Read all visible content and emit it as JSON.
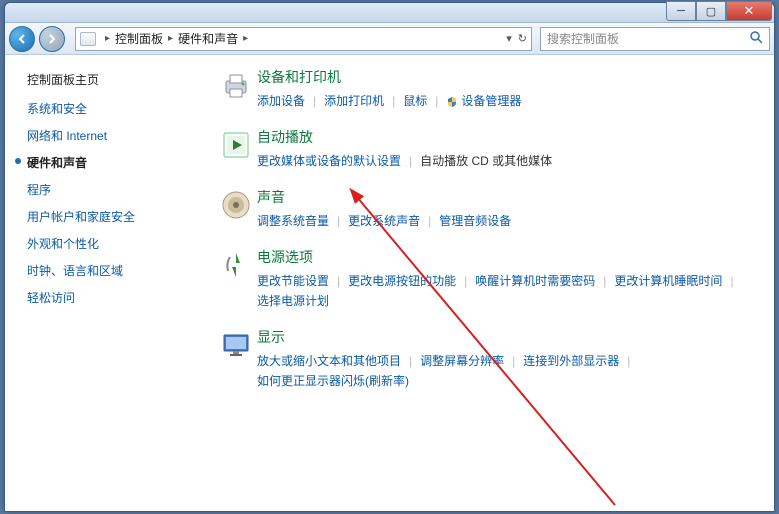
{
  "window": {
    "breadcrumb": {
      "root": "控制面板",
      "current": "硬件和声音"
    },
    "search_placeholder": "搜索控制面板"
  },
  "sidebar": {
    "title": "控制面板主页",
    "items": [
      {
        "label": "系统和安全",
        "active": false
      },
      {
        "label": "网络和 Internet",
        "active": false
      },
      {
        "label": "硬件和声音",
        "active": true
      },
      {
        "label": "程序",
        "active": false
      },
      {
        "label": "用户帐户和家庭安全",
        "active": false
      },
      {
        "label": "外观和个性化",
        "active": false
      },
      {
        "label": "时钟、语言和区域",
        "active": false
      },
      {
        "label": "轻松访问",
        "active": false
      }
    ]
  },
  "sections": [
    {
      "title": "设备和打印机",
      "icon": "printer",
      "links": [
        {
          "text": "添加设备"
        },
        {
          "sep": true
        },
        {
          "text": "添加打印机"
        },
        {
          "sep": true
        },
        {
          "text": "鼠标"
        },
        {
          "sep": true
        },
        {
          "shield": true,
          "text": "设备管理器"
        }
      ]
    },
    {
      "title": "自动播放",
      "icon": "autoplay",
      "links": [
        {
          "text": "更改媒体或设备的默认设置"
        },
        {
          "sep": true
        },
        {
          "plain": true,
          "text": "自动播放 CD 或其他媒体"
        }
      ]
    },
    {
      "title": "声音",
      "icon": "sound",
      "links": [
        {
          "text": "调整系统音量"
        },
        {
          "sep": true
        },
        {
          "text": "更改系统声音"
        },
        {
          "sep": true
        },
        {
          "text": "管理音频设备"
        }
      ]
    },
    {
      "title": "电源选项",
      "icon": "power",
      "links": [
        {
          "text": "更改节能设置"
        },
        {
          "sep": true
        },
        {
          "text": "更改电源按钮的功能"
        },
        {
          "sep": true
        },
        {
          "text": "唤醒计算机时需要密码"
        },
        {
          "sep": true
        },
        {
          "text": "更改计算机睡眠时间"
        },
        {
          "sep": true
        },
        {
          "text": "选择电源计划"
        }
      ]
    },
    {
      "title": "显示",
      "icon": "display",
      "links": [
        {
          "text": "放大或缩小文本和其他项目"
        },
        {
          "sep": true
        },
        {
          "text": "调整屏幕分辨率"
        },
        {
          "sep": true
        },
        {
          "text": "连接到外部显示器"
        },
        {
          "sep": true
        },
        {
          "text": "如何更正显示器闪烁(刷新率)"
        }
      ]
    }
  ]
}
